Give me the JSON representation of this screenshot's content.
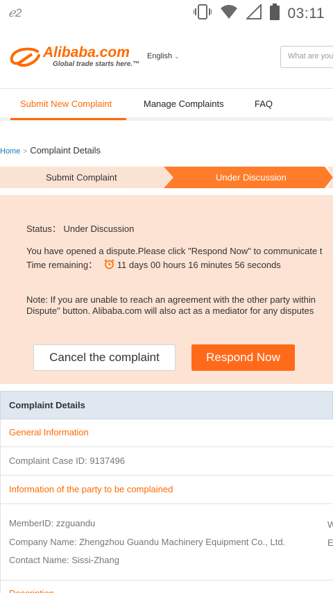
{
  "status_bar": {
    "notification_icon": "alibaba-notification-icon",
    "time": "03:11",
    "icons": [
      "vibrate-icon",
      "wifi-icon",
      "signal-icon",
      "battery-icon"
    ]
  },
  "header": {
    "logo_text": "Alibaba.com",
    "logo_tagline": "Global trade starts here.™",
    "language": "English",
    "search_placeholder": "What are you"
  },
  "tabs": [
    {
      "label": "Submit New Complaint",
      "active": true
    },
    {
      "label": "Manage Complaints",
      "active": false
    },
    {
      "label": "FAQ",
      "active": false
    }
  ],
  "breadcrumb": {
    "home": "Home",
    "separator": ">",
    "current": "Complaint Details"
  },
  "steps": [
    {
      "label": "Submit Complaint",
      "state": "done"
    },
    {
      "label": "Under Discussion",
      "state": "current"
    }
  ],
  "status_panel": {
    "status_label": "Status：",
    "status_value": "Under Discussion",
    "dispute_text": "You have opened a dispute.Please click \"Respond Now\" to communicate t",
    "time_label": "Time remaining：",
    "time_value": "11 days  00 hours  16 minutes  56 seconds",
    "note_line1": "Note: If you are unable to reach an agreement with the other party within",
    "note_line2": "Dispute\" button. Alibaba.com will also act as a mediator for any disputes",
    "cancel_button": "Cancel the complaint",
    "respond_button": "Respond Now"
  },
  "details": {
    "heading": "Complaint Details",
    "general_info": "General Information",
    "case_id": "Complaint Case ID: 9137496",
    "party_info": "Information of the party to be complained",
    "member_id": "MemberID: zzguandu",
    "company": "Company Name: Zhengzhou Guandu Machinery Equipment Co., Ltd.",
    "contact": "Contact Name: Sissi-Zhang",
    "right_edge_1": "W",
    "right_edge_2": "E",
    "description": "Description"
  },
  "colors": {
    "accent": "#ff6a00",
    "panel_bg": "#fde3d3",
    "step_done": "#fbe3d4",
    "step_current": "#ff7c2a",
    "link": "#1a7ab8"
  }
}
